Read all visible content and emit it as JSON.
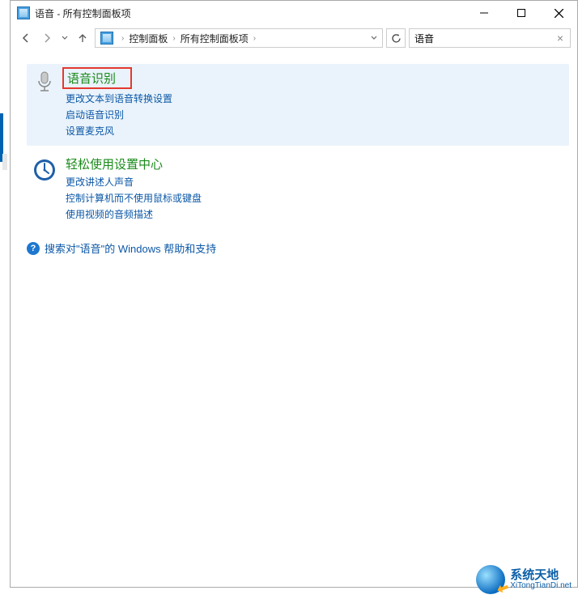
{
  "titlebar": {
    "title": "语音 - 所有控制面板项"
  },
  "breadcrumb": {
    "seg1": "控制面板",
    "seg2": "所有控制面板项"
  },
  "search": {
    "value": "语音"
  },
  "results": [
    {
      "title": "语音识别",
      "links": [
        "更改文本到语音转换设置",
        "启动语音识别",
        "设置麦克风"
      ]
    },
    {
      "title": "轻松使用设置中心",
      "links": [
        "更改讲述人声音",
        "控制计算机而不使用鼠标或键盘",
        "使用视频的音频描述"
      ]
    }
  ],
  "help": {
    "text": "搜索对\"语音\"的 Windows 帮助和支持"
  },
  "watermark": {
    "cn": "系统天地",
    "en": "XiTongTianDi.net"
  }
}
